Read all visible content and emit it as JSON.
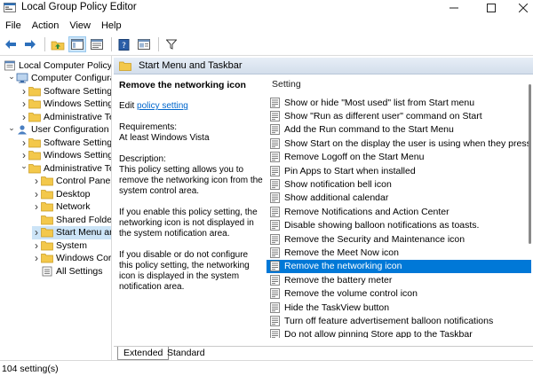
{
  "window": {
    "title": "Local Group Policy Editor"
  },
  "menu": [
    "File",
    "Action",
    "View",
    "Help"
  ],
  "toolbar": {
    "icons": [
      "back-arrow-icon",
      "forward-arrow-icon",
      "up-folder-icon",
      "show-tree-icon",
      "export-list-icon",
      "help-icon",
      "properties-icon",
      "filter-icon"
    ]
  },
  "tree": [
    {
      "label": "Local Computer Policy",
      "level": 0,
      "icon": "computer-policy-icon",
      "expander": ""
    },
    {
      "label": "Computer Configura",
      "level": 1,
      "icon": "computer-config-icon",
      "expander": "expanded"
    },
    {
      "label": "Software Settings",
      "level": 2,
      "icon": "folder-icon",
      "expander": "collapsed"
    },
    {
      "label": "Windows Setting",
      "level": 2,
      "icon": "folder-icon",
      "expander": "collapsed"
    },
    {
      "label": "Administrative Te",
      "level": 2,
      "icon": "folder-icon",
      "expander": "collapsed"
    },
    {
      "label": "User Configuration",
      "level": 1,
      "icon": "user-config-icon",
      "expander": "expanded"
    },
    {
      "label": "Software Settings",
      "level": 2,
      "icon": "folder-icon",
      "expander": "collapsed"
    },
    {
      "label": "Windows Setting",
      "level": 2,
      "icon": "folder-icon",
      "expander": "collapsed"
    },
    {
      "label": "Administrative Te",
      "level": 2,
      "icon": "folder-icon",
      "expander": "expanded"
    },
    {
      "label": "Control Panel",
      "level": 3,
      "icon": "folder-icon",
      "expander": "collapsed"
    },
    {
      "label": "Desktop",
      "level": 3,
      "icon": "folder-icon",
      "expander": "collapsed"
    },
    {
      "label": "Network",
      "level": 3,
      "icon": "folder-icon",
      "expander": "collapsed"
    },
    {
      "label": "Shared Folder",
      "level": 3,
      "icon": "folder-icon",
      "expander": ""
    },
    {
      "label": "Start Menu ar",
      "level": 3,
      "icon": "folder-icon",
      "expander": "collapsed",
      "selected": true
    },
    {
      "label": "System",
      "level": 3,
      "icon": "folder-icon",
      "expander": "collapsed"
    },
    {
      "label": "Windows Cor",
      "level": 3,
      "icon": "folder-icon",
      "expander": "collapsed"
    },
    {
      "label": "All Settings",
      "level": 3,
      "icon": "all-settings-icon",
      "expander": ""
    }
  ],
  "header": {
    "title": "Start Menu and Taskbar"
  },
  "description": {
    "policy_title": "Remove the networking icon",
    "edit_prefix": "Edit ",
    "edit_link": "policy setting",
    "requirements_label": "Requirements:",
    "requirements_value": "At least Windows Vista",
    "description_label": "Description:",
    "p1": "This policy setting allows you to remove the networking icon from the system control area.",
    "p2": "If you enable this policy setting, the networking icon is not displayed in the system notification area.",
    "p3": "If you disable or do not configure this policy setting, the networking icon is displayed in the system notification area."
  },
  "list": {
    "column_header": "Setting",
    "rows": [
      "Show or hide \"Most used\" list from Start menu",
      "Show \"Run as different user\" command on Start",
      "Add the Run command to the Start Menu",
      "Show Start on the display the user is using when they press t...",
      "Remove Logoff on the Start Menu",
      "Pin Apps to Start when installed",
      "Show notification bell icon",
      "Show additional calendar",
      "Remove Notifications and Action Center",
      "Disable showing balloon notifications as toasts.",
      "Remove the Security and Maintenance icon",
      "Remove the Meet Now icon",
      "Remove the networking icon",
      "Remove the battery meter",
      "Remove the volume control icon",
      "Hide the TaskView button",
      "Turn off feature advertisement balloon notifications",
      "Do not allow pinning Store app to the Taskbar"
    ],
    "selected_index": 12
  },
  "tabs": {
    "extended": "Extended",
    "standard": "Standard"
  },
  "status": {
    "text": "104 setting(s)"
  },
  "colors": {
    "selection": "#0078d7",
    "link": "#0066cc",
    "header_band": "#dbe4ef"
  }
}
